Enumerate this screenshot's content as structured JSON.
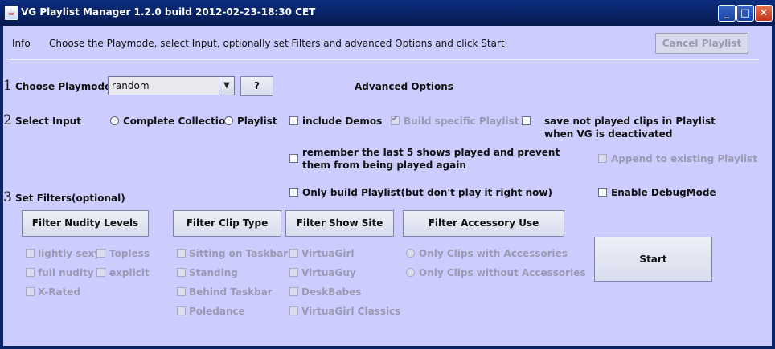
{
  "window": {
    "title": "VG Playlist Manager 1.2.0 build 2012-02-23-18:30 CET"
  },
  "info": {
    "label": "Info",
    "text": "Choose the Playmode, select Input, optionally set Filters and advanced Options and click Start",
    "cancel_label": "Cancel Playlist"
  },
  "step1": {
    "number": "1",
    "label": "Choose Playmode",
    "playmode": "random",
    "help_label": "?"
  },
  "advanced_label": "Advanced Options",
  "step2": {
    "number": "2",
    "label": "Select Input",
    "radio_complete": "Complete Collection",
    "radio_playlist": "Playlist"
  },
  "step3": {
    "number": "3",
    "label": "Set Filters(optional)"
  },
  "options": {
    "include_demos": "include Demos",
    "build_specific": "Build specific Playlist",
    "save_not_played_1": "save not played clips in Playlist",
    "save_not_played_2": "when VG is deactivated",
    "remember_1": "remember the last 5 shows played and prevent",
    "remember_2": "them from being played again",
    "append_existing": "Append to existing Playlist",
    "only_build": "Only build Playlist(but don't play it right now)",
    "enable_debug": "Enable DebugMode"
  },
  "filter_buttons": {
    "nudity": "Filter Nudity Levels",
    "clip_type": "Filter Clip Type",
    "show_site": "Filter Show Site",
    "accessory": "Filter Accessory Use"
  },
  "nudity": {
    "lightly_sexy": "lightly sexy",
    "topless": "Topless",
    "full_nudity": "full nudity",
    "explicit": "explicit",
    "x_rated": "X-Rated"
  },
  "clip_type": [
    "Sitting on Taskbar",
    "Standing",
    "Behind Taskbar",
    "Poledance"
  ],
  "show_site": [
    "VirtuaGirl",
    "VirtuaGuy",
    "DeskBabes",
    "VirtuaGirl Classics"
  ],
  "accessory": [
    "Only Clips with Accessories",
    "Only Clips without Accessories"
  ],
  "start_label": "Start"
}
